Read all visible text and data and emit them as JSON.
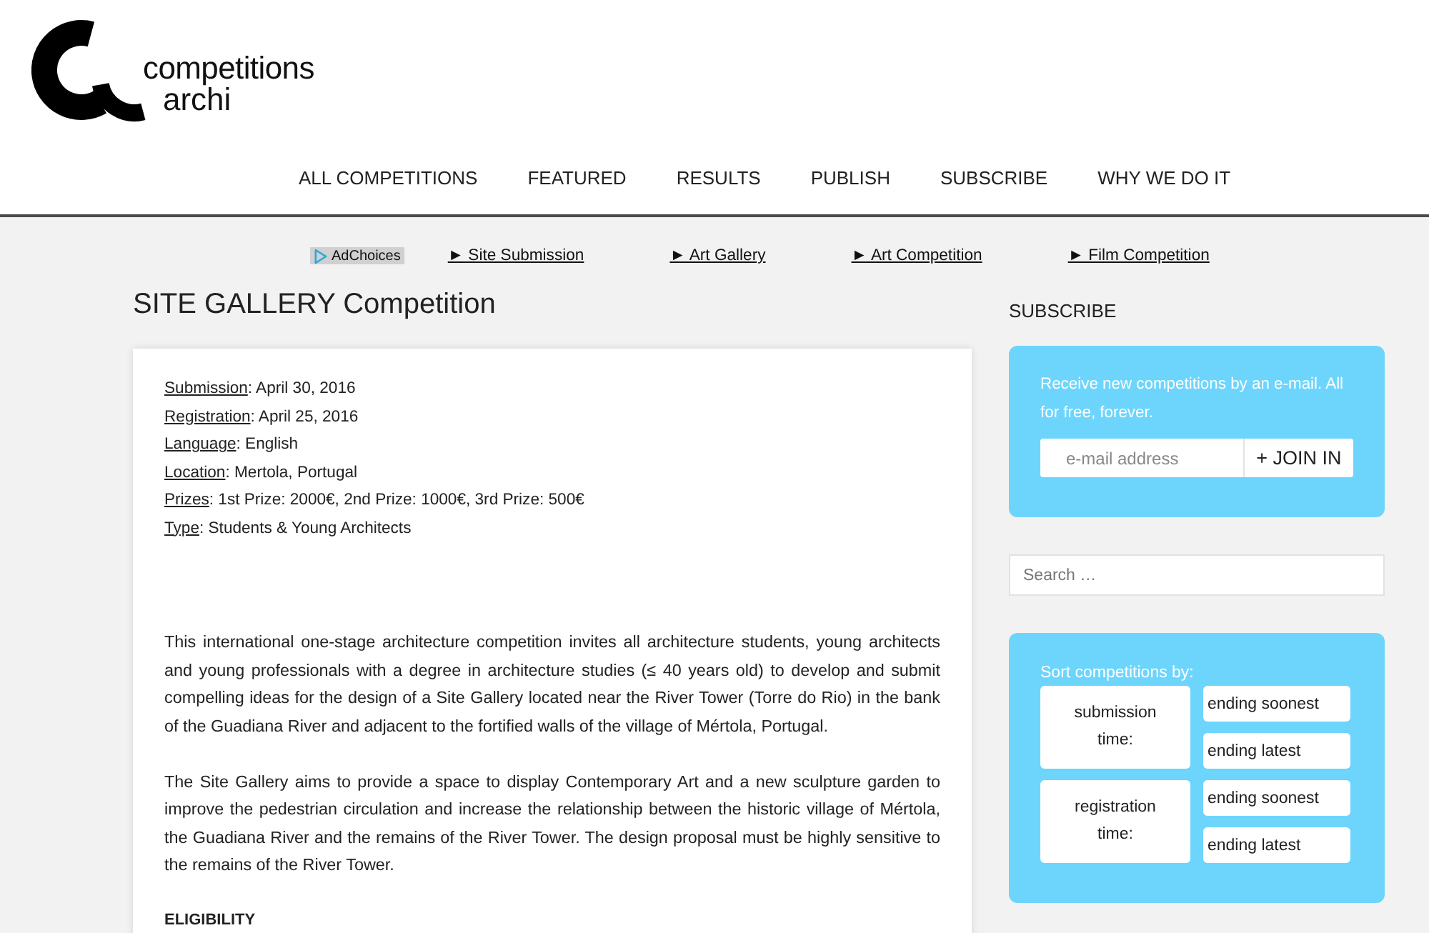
{
  "logo": {
    "line_1": "competitions",
    "line_2": "archi"
  },
  "nav": [
    "ALL COMPETITIONS",
    "FEATURED",
    "RESULTS",
    "PUBLISH",
    "SUBSCRIBE",
    "WHY WE DO IT"
  ],
  "ad_bar": {
    "badge": "AdChoices",
    "links": [
      "► Site Submission",
      "► Art Gallery",
      "► Art Competition",
      "► Film Competition"
    ]
  },
  "article": {
    "title": "SITE GALLERY Competition",
    "details": [
      {
        "label": "Submission",
        "value": ": April 30, 2016"
      },
      {
        "label": "Registration",
        "value": ": April 25, 2016"
      },
      {
        "label": "Language",
        "value": ": English"
      },
      {
        "label": "Location",
        "value": ": Mertola, Portugal"
      },
      {
        "label": "Prizes",
        "value": ": 1st Prize: 2000€, 2nd Prize: 1000€, 3rd Prize: 500€"
      },
      {
        "label": "Type",
        "value": ": Students & Young Architects"
      }
    ],
    "paragraphs": [
      "This international one-stage architecture competition invites all architecture students, young architects and young professionals with a degree in architecture studies (≤ 40 years old) to develop and submit compelling ideas for the design of a Site Gallery located near the River Tower (Torre do Rio) in the bank of the Guadiana River and adjacent to the fortified walls of the village of Mértola, Portugal.",
      "The Site Gallery aims to provide a space to display Contemporary Art and a new sculpture garden to improve the pedestrian circulation and increase the relationship between the historic village of Mértola, the Guadiana River and the remains of the River Tower. The design proposal must be highly sensitive to the remains of the River Tower."
    ],
    "section_heading": "ELIGIBILITY"
  },
  "sidebar": {
    "subscribe": {
      "heading": "SUBSCRIBE",
      "text": "Receive new competitions by an e-mail. All for free, forever.",
      "placeholder": "e-mail address",
      "button": "+ JOIN IN"
    },
    "search": {
      "placeholder": "Search …"
    },
    "sort": {
      "title": "Sort competitions by:",
      "groups": [
        {
          "label": "submission time:",
          "options": [
            "ending soonest",
            "ending latest"
          ]
        },
        {
          "label": "registration time:",
          "options": [
            "ending soonest",
            "ending latest"
          ]
        }
      ]
    }
  }
}
